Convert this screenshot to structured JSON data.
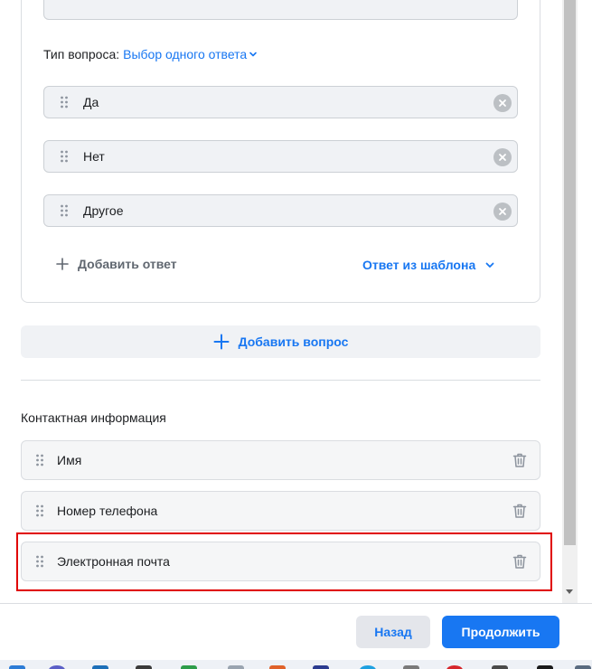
{
  "question": {
    "type_label": "Тип вопроса:",
    "type_value": "Выбор одного ответа",
    "answers": [
      "Да",
      "Нет",
      "Другое"
    ],
    "add_answer_label": "Добавить ответ",
    "template_answer_label": "Ответ из шаблона"
  },
  "add_question_label": "Добавить вопрос",
  "contact": {
    "title": "Контактная информация",
    "fields": [
      "Имя",
      "Номер телефона",
      "Электронная почта"
    ]
  },
  "footer": {
    "back_label": "Назад",
    "continue_label": "Продолжить"
  },
  "colors": {
    "accent": "#1877f2",
    "highlight": "#e00000"
  }
}
